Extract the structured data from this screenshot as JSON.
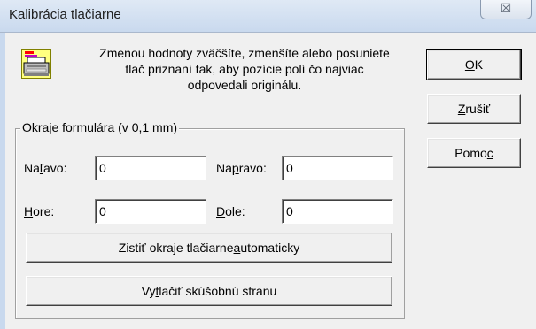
{
  "window": {
    "title": "Kalibrácia tlačiarne",
    "close_glyph": "☒"
  },
  "info": {
    "line1": "Zmenou hodnoty zväčšíte, zmenšíte alebo posuniete",
    "line2": "tlač priznaní tak, aby pozície polí čo najviac",
    "line3": "odpovedali originálu.",
    "icon": "printer-icon"
  },
  "buttons": {
    "ok": {
      "pre": "",
      "key": "O",
      "post": "K"
    },
    "cancel": {
      "pre": "",
      "key": "Z",
      "post": "rušiť"
    },
    "help": {
      "pre": "Pomo",
      "key": "c",
      "post": ""
    },
    "auto_detect": {
      "pre": "Zistiť okraje tlačiarne ",
      "key": "a",
      "post": "utomaticky"
    },
    "print_test": {
      "pre": "Vy",
      "key": "t",
      "post": "lačiť skúšobnú stranu"
    }
  },
  "margins": {
    "group_label": "Okraje formulára (v 0,1 mm)",
    "left": {
      "pre": "Na",
      "key": "ľ",
      "post": "avo:",
      "value": "0"
    },
    "right": {
      "pre": "Na",
      "key": "p",
      "post": "ravo:",
      "value": "0"
    },
    "top": {
      "pre": "",
      "key": "H",
      "post": "ore:",
      "value": "0"
    },
    "bottom": {
      "pre": "",
      "key": "D",
      "post": "ole:",
      "value": "0"
    }
  }
}
